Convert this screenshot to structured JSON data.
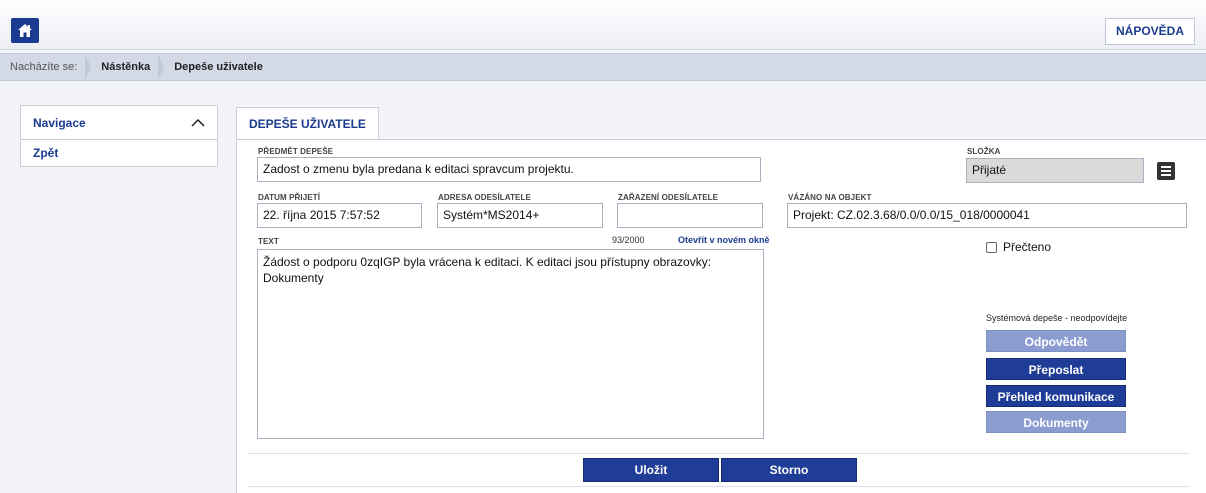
{
  "header": {
    "help_label": "NÁPOVĚDA"
  },
  "breadcrumb": {
    "label": "Nacházíte se:",
    "items": [
      "Nástěnka",
      "Depeše uživatele"
    ]
  },
  "navigation": {
    "title": "Navigace",
    "items": [
      "Zpět"
    ]
  },
  "tab": {
    "label": "DEPEŠE UŽIVATELE"
  },
  "form": {
    "subject": {
      "label": "PŘEDMĚT DEPEŠE",
      "value": "Zadost o zmenu byla predana k editaci spravcum projektu."
    },
    "folder": {
      "label": "SLOŽKA",
      "value": "Přijaté"
    },
    "received_date": {
      "label": "DATUM PŘIJETÍ",
      "value": "22. října 2015 7:57:52"
    },
    "sender_address": {
      "label": "ADRESA ODESÍLATELE",
      "value": "Systém*MS2014+"
    },
    "sender_category": {
      "label": "ZAŘAZENÍ ODESÍLATELE",
      "value": ""
    },
    "bound_object": {
      "label": "VÁZÁNO NA OBJEKT",
      "value": "Projekt: CZ.02.3.68/0.0/0.0/15_018/0000041"
    },
    "text": {
      "label": "TEXT",
      "counter": "93/2000",
      "open_link": "Otevřít v novém okně",
      "value": "Žádost o podporu 0zqIGP byla vrácena k editaci. K editaci jsou přístupny obrazovky: Dokumenty"
    },
    "read_checkbox": {
      "label": "Přečteno",
      "checked": false
    }
  },
  "actions": {
    "system_message": "Systémová depeše - neodpovídejte",
    "buttons": [
      {
        "label": "Odpovědět",
        "enabled": false
      },
      {
        "label": "Přeposlat",
        "enabled": true
      },
      {
        "label": "Přehled komunikace",
        "enabled": true
      },
      {
        "label": "Dokumenty",
        "enabled": false
      }
    ]
  },
  "footer": {
    "save_label": "Uložit",
    "cancel_label": "Storno"
  },
  "colors": {
    "primary": "#1f3c96",
    "disabled": "#8a9cd0",
    "crumbbar": "#d4d9e6"
  }
}
